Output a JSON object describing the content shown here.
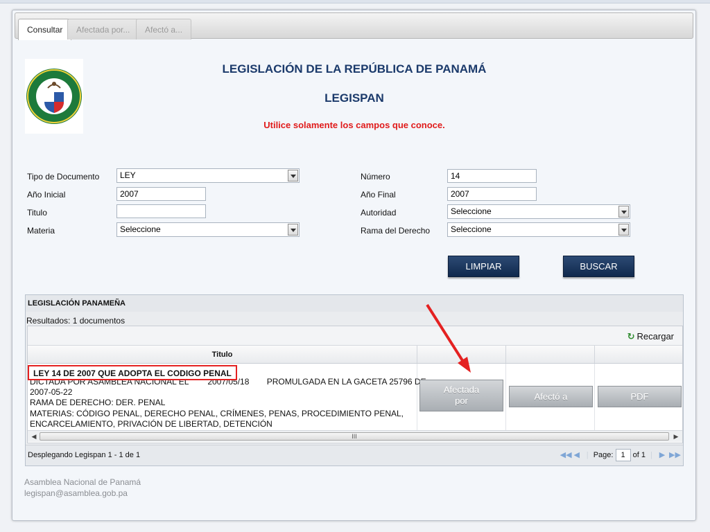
{
  "tabs": [
    "Consultar",
    "Afectada por...",
    "Afectó a..."
  ],
  "header": {
    "title": "LEGISLACIÓN DE LA REPÚBLICA DE PANAMÁ",
    "subtitle": "LEGISPAN",
    "note": "Utilice solamente los campos que conoce.",
    "logo_text_top": "ASAMBLEA NACIONAL",
    "logo_text_bottom": "PANAMA"
  },
  "form": {
    "tipo_label": "Tipo de Documento",
    "tipo_value": "LEY",
    "anio_inicial_label": "Año Inicial",
    "anio_inicial_value": "2007",
    "titulo_label": "Titulo",
    "titulo_value": "",
    "materia_label": "Materia",
    "materia_value": "Seleccione",
    "numero_label": "Número",
    "numero_value": "14",
    "anio_final_label": "Año Final",
    "anio_final_value": "2007",
    "autoridad_label": "Autoridad",
    "autoridad_value": "Seleccione",
    "rama_label": "Rama del Derecho",
    "rama_value": "Seleccione",
    "limpiar": "LIMPIAR",
    "buscar": "BUSCAR"
  },
  "results": {
    "panel_title": "LEGISLACIÓN PANAMEÑA",
    "count": "Resultados: 1 documentos",
    "reload": "Recargar",
    "column_titulo": "Titulo",
    "row": {
      "title": "LEY 14 DE 2007 QUE ADOPTA EL CODIGO PENAL",
      "line1a": "DICTADA POR  ASAMBLEA NACIONAL EL",
      "line1b": "2007/05/18",
      "line1c": "PROMULGADA EN LA GACETA 25796 DE",
      "line2": "2007-05-22",
      "line3": "RAMA DE DERECHO:  DER. PENAL",
      "line4": "MATERIAS: CÓDIGO PENAL, DERECHO PENAL, CRÍMENES, PENAS, PROCEDIMIENTO PENAL,",
      "line5": "ENCARCELAMIENTO, PRIVACIÓN DE LIBERTAD, DETENCIÓN",
      "btn_afectada_1": "Afectada",
      "btn_afectada_2": "por",
      "btn_afecto": "Afectó a",
      "btn_pdf": "PDF"
    },
    "scroll_mark": "III",
    "pager_info": "Desplegando Legispan 1 - 1 de 1",
    "page_label": "Page:",
    "page_value": "1",
    "page_of": "of 1"
  },
  "footer": {
    "line1": "Asamblea Nacional de Panamá",
    "line2": "legispan@asamblea.gob.pa"
  },
  "colors": {
    "title_blue": "#1b3a6b",
    "note_red": "#e01b1b",
    "button_dark": "#1a3560",
    "highlight_red": "#e42121"
  }
}
